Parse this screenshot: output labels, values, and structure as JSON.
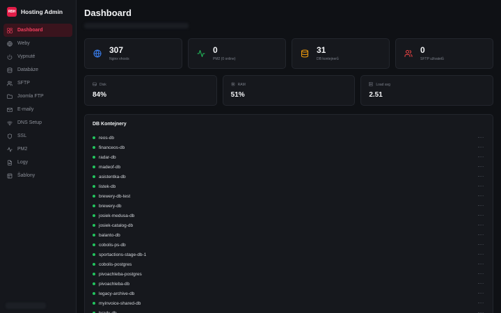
{
  "app": {
    "logo_text": "RBH",
    "name": "Hosting Admin"
  },
  "sidebar": {
    "items": [
      {
        "label": "Dashboard",
        "icon": "dashboard-icon",
        "active": true
      },
      {
        "label": "Weby",
        "icon": "globe-icon"
      },
      {
        "label": "Vypnuté",
        "icon": "power-icon"
      },
      {
        "label": "Databáze",
        "icon": "database-icon"
      },
      {
        "label": "SFTP",
        "icon": "users-icon"
      },
      {
        "label": "Joomla FTP",
        "icon": "folder-icon"
      },
      {
        "label": "E-maily",
        "icon": "mail-icon"
      },
      {
        "label": "DNS Setup",
        "icon": "wifi-icon"
      },
      {
        "label": "SSL",
        "icon": "shield-icon"
      },
      {
        "label": "PM2",
        "icon": "activity-icon"
      },
      {
        "label": "Logy",
        "icon": "file-icon"
      },
      {
        "label": "Šablony",
        "icon": "template-icon"
      }
    ]
  },
  "header": {
    "title": "Dashboard"
  },
  "stats": [
    {
      "value": "307",
      "label": "Nginx vhosts",
      "icon": "globe-icon",
      "color": "#3b82f6"
    },
    {
      "value": "0",
      "label": "PM2 (0 online)",
      "icon": "activity-icon",
      "color": "#22c55e"
    },
    {
      "value": "31",
      "label": "DB kontejnerů",
      "icon": "database-icon",
      "color": "#f59e0b"
    },
    {
      "value": "0",
      "label": "SFTP uživatelů",
      "icon": "users-icon",
      "color": "#ef4444"
    }
  ],
  "resources": [
    {
      "label": "Disk",
      "value": "84%",
      "icon": "disk-icon"
    },
    {
      "label": "RAM",
      "value": "51%",
      "icon": "cpu-icon"
    },
    {
      "label": "Load avg",
      "value": "2.51",
      "icon": "server-icon"
    }
  ],
  "db_panel": {
    "title": "DB Kontejnery",
    "status_color": "#22c55e",
    "containers": [
      "reos-db",
      "financeos-db",
      "radar-db",
      "madeof-db",
      "asistentka-db",
      "listek-db",
      "brewery-db-test",
      "brewery-db",
      "josiek-medusa-db",
      "josiek-catalog-db",
      "balanto-db",
      "cobolis-ps-db",
      "sportactions-stage-db-1",
      "cobolis-postgres",
      "pivoachleba-postgres",
      "pivoachleba-db",
      "legacy-archive-db",
      "myinvoice-shared-db",
      "hrady-db"
    ]
  }
}
